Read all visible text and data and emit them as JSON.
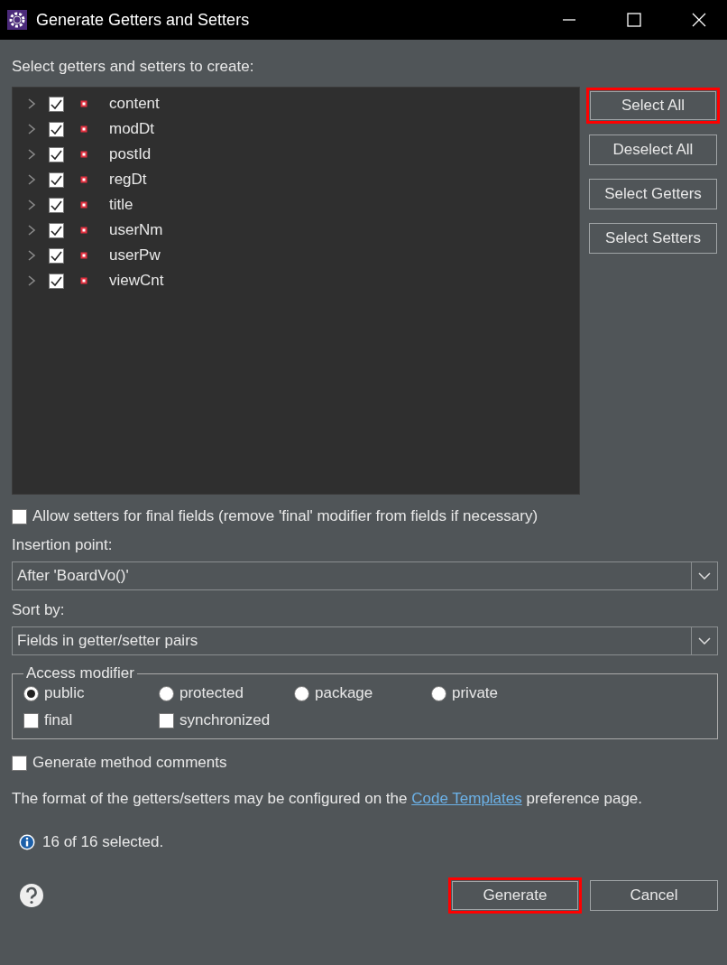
{
  "window": {
    "title": "Generate Getters and Setters",
    "controls": [
      {
        "kind": "minimize"
      },
      {
        "kind": "maximize"
      },
      {
        "kind": "close"
      }
    ]
  },
  "prompt": "Select getters and setters to create:",
  "fields": [
    {
      "name": "content",
      "checked": true,
      "expanded": false
    },
    {
      "name": "modDt",
      "checked": true,
      "expanded": false
    },
    {
      "name": "postId",
      "checked": true,
      "expanded": false
    },
    {
      "name": "regDt",
      "checked": true,
      "expanded": false
    },
    {
      "name": "title",
      "checked": true,
      "expanded": false
    },
    {
      "name": "userNm",
      "checked": true,
      "expanded": false
    },
    {
      "name": "userPw",
      "checked": true,
      "expanded": false
    },
    {
      "name": "viewCnt",
      "checked": true,
      "expanded": false
    }
  ],
  "side_buttons": [
    {
      "label": "Select All",
      "highlighted": true
    },
    {
      "label": "Deselect All",
      "highlighted": false
    },
    {
      "label": "Select Getters",
      "highlighted": false
    },
    {
      "label": "Select Setters",
      "highlighted": false
    }
  ],
  "allow_setters_final": {
    "label": "Allow setters for final fields (remove 'final' modifier from fields if necessary)",
    "checked": false
  },
  "insertion_point": {
    "label": "Insertion point:",
    "value": "After 'BoardVo()'"
  },
  "sort_by": {
    "label": "Sort by:",
    "value": "Fields in getter/setter pairs"
  },
  "access_modifier": {
    "title": "Access modifier",
    "visibility": [
      {
        "label": "public",
        "selected": true
      },
      {
        "label": "protected",
        "selected": false
      },
      {
        "label": "package",
        "selected": false
      },
      {
        "label": "private",
        "selected": false
      }
    ],
    "modifiers": [
      {
        "label": "final",
        "checked": false
      },
      {
        "label": "synchronized",
        "checked": false
      }
    ]
  },
  "generate_comments": {
    "label": "Generate method comments",
    "checked": false
  },
  "format_note": {
    "before": "The format of the getters/setters may be configured on the",
    "link": "Code Templates",
    "after": "preference page."
  },
  "status": "16 of 16 selected.",
  "footer_buttons": [
    {
      "label": "Generate",
      "highlighted": true
    },
    {
      "label": "Cancel",
      "highlighted": false
    }
  ]
}
